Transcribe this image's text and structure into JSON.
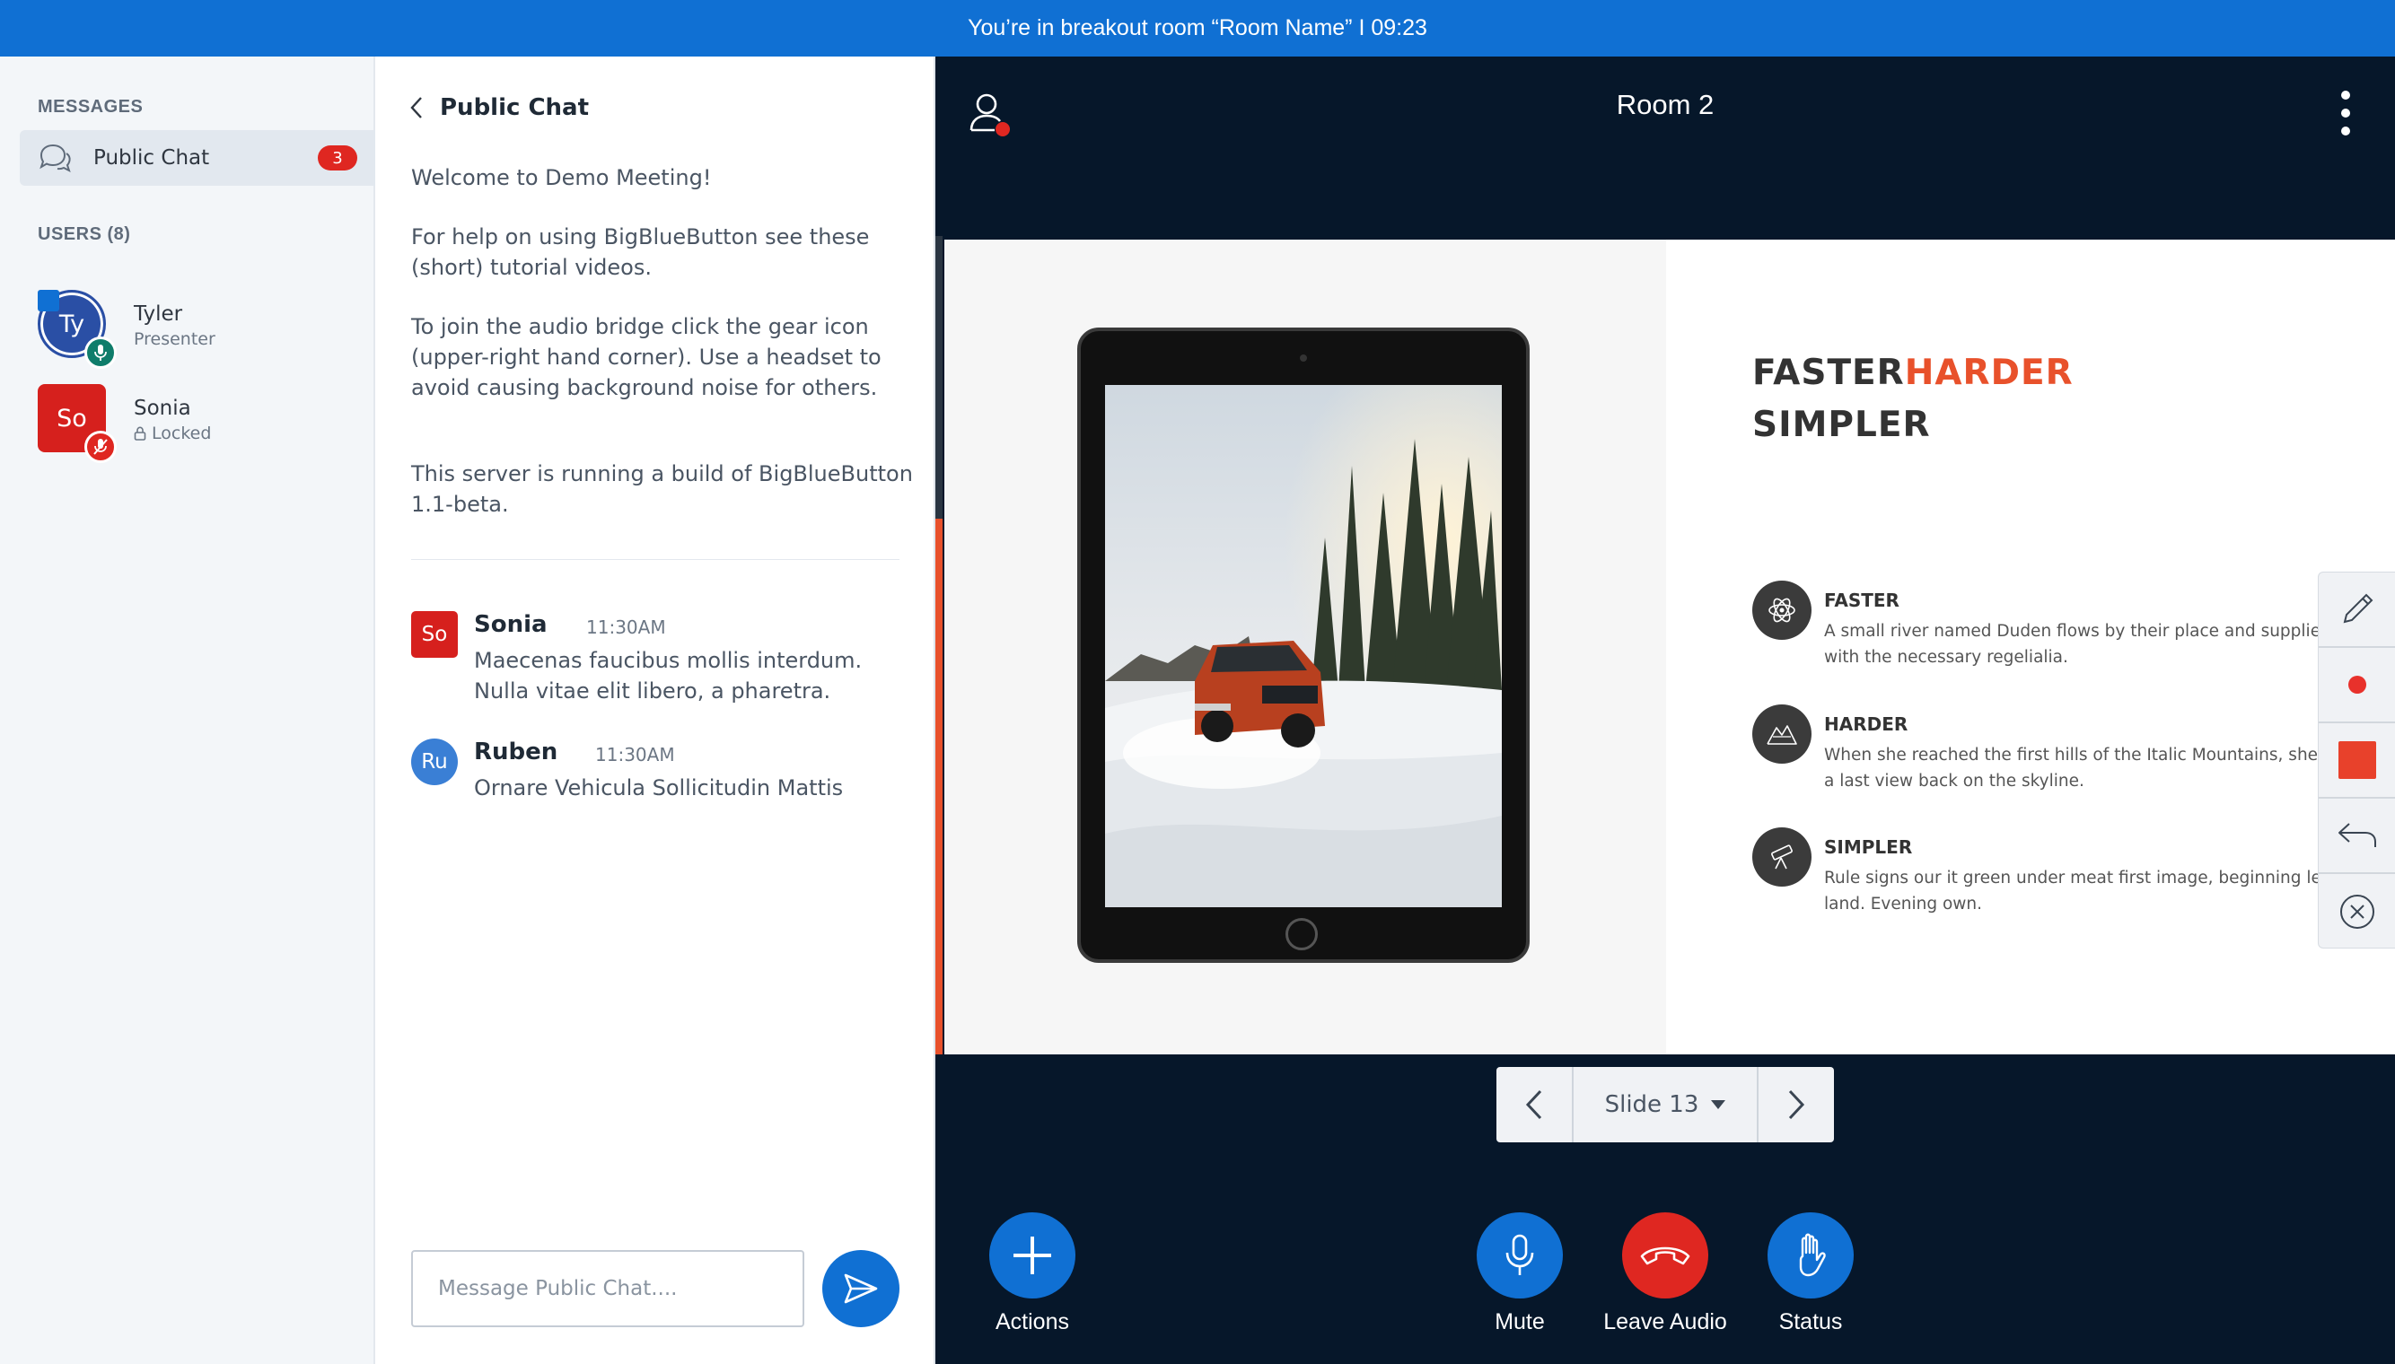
{
  "banner": {
    "text": "You’re in breakout room “Room Name” I 09:23"
  },
  "users_panel": {
    "messages_title": "MESSAGES",
    "public_chat": {
      "label": "Public Chat",
      "unread": "3"
    },
    "users_title": "USERS (8)",
    "users": [
      {
        "initials": "Ty",
        "name": "Tyler",
        "role": "Presenter"
      },
      {
        "initials": "So",
        "name": "Sonia",
        "role": "Locked"
      }
    ]
  },
  "chat": {
    "title": "Public Chat",
    "welcome": "Welcome to Demo Meeting!",
    "help": "For help on using BigBlueButton see these (short) tutorial videos.",
    "audio": "To join the audio bridge click the gear icon (upper-right hand corner). Use a headset to avoid causing background noise for others.",
    "server": "This server is running a build of BigBlueButton 1.1-beta.",
    "messages": [
      {
        "initials": "So",
        "name": "Sonia",
        "time": "11:30AM",
        "text": "Maecenas faucibus mollis interdum. Nulla vitae elit libero, a pharetra."
      },
      {
        "initials": "Ru",
        "name": "Ruben",
        "time": "11:30AM",
        "text": "Ornare Vehicula Sollicitudin Mattis"
      }
    ],
    "input_placeholder": "Message Public Chat...."
  },
  "main": {
    "room_title": "Room 2",
    "slide": {
      "headline_part1": "FASTER",
      "headline_part2": "HARDER",
      "headline_line2": "SIMPLER",
      "features": [
        {
          "title": "FASTER",
          "line1": "A small river named Duden flows by their place and supplies it",
          "line2": "with the necessary regelialia."
        },
        {
          "title": "HARDER",
          "line1": "When she reached the first hills of the Italic Mountains, she had",
          "line2": "a last view back on the skyline."
        },
        {
          "title": "SIMPLER",
          "line1": "Rule signs our it green under meat first image, beginning lesser",
          "line2": "land. Evening own."
        }
      ]
    },
    "slide_selector": "Slide 13",
    "actions": {
      "actions": "Actions",
      "mute": "Mute",
      "leave_audio": "Leave Audio",
      "status": "Status"
    },
    "colors": {
      "accent": "#1070d3",
      "danger": "#df2721",
      "background": "#06172a",
      "highlight": "#e8512b"
    }
  }
}
